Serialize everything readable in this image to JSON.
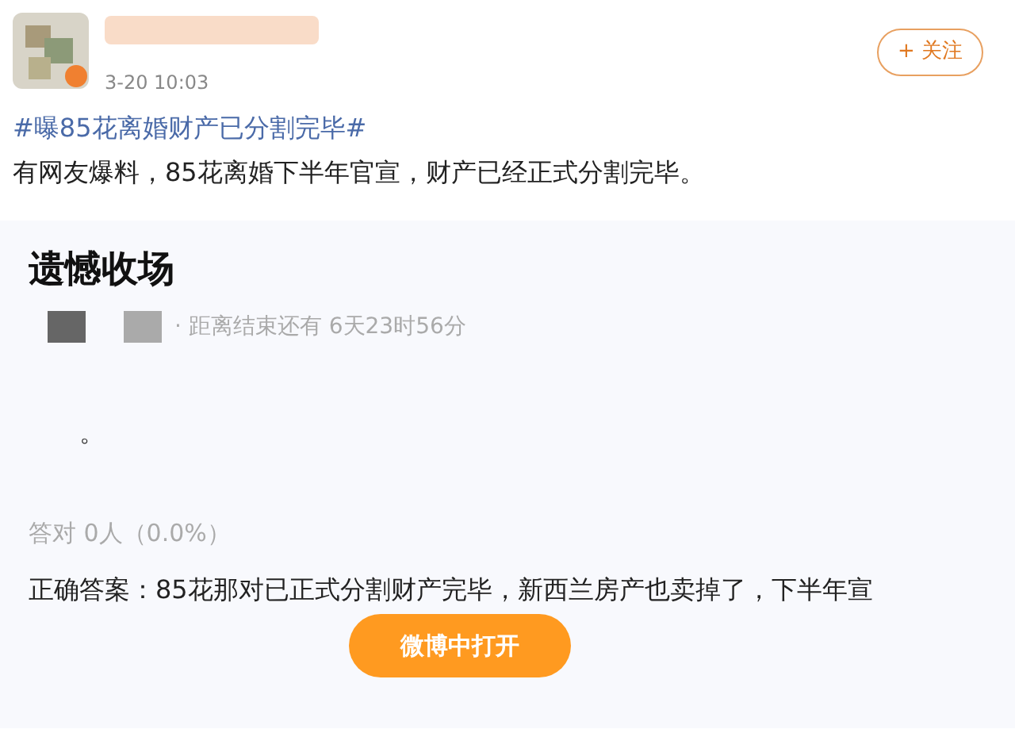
{
  "post": {
    "time": "3-20 10:03",
    "follow_button": "+ 关注",
    "hashtag": "#曝85花离婚财产已分割完毕#",
    "body": "有网友爆料，85花离婚下半年官宣，财产已经正式分割完毕。"
  },
  "quiz": {
    "title": "遗憾收场",
    "countdown": "· 距离结束还有 6天23时56分",
    "option": "。",
    "result": "答对 0人（0.0%）",
    "answer": "正确答案：85花那对已正式分割财产完毕，新西兰房产也卖掉了，下半年宣",
    "open_button": "微博中打开"
  }
}
